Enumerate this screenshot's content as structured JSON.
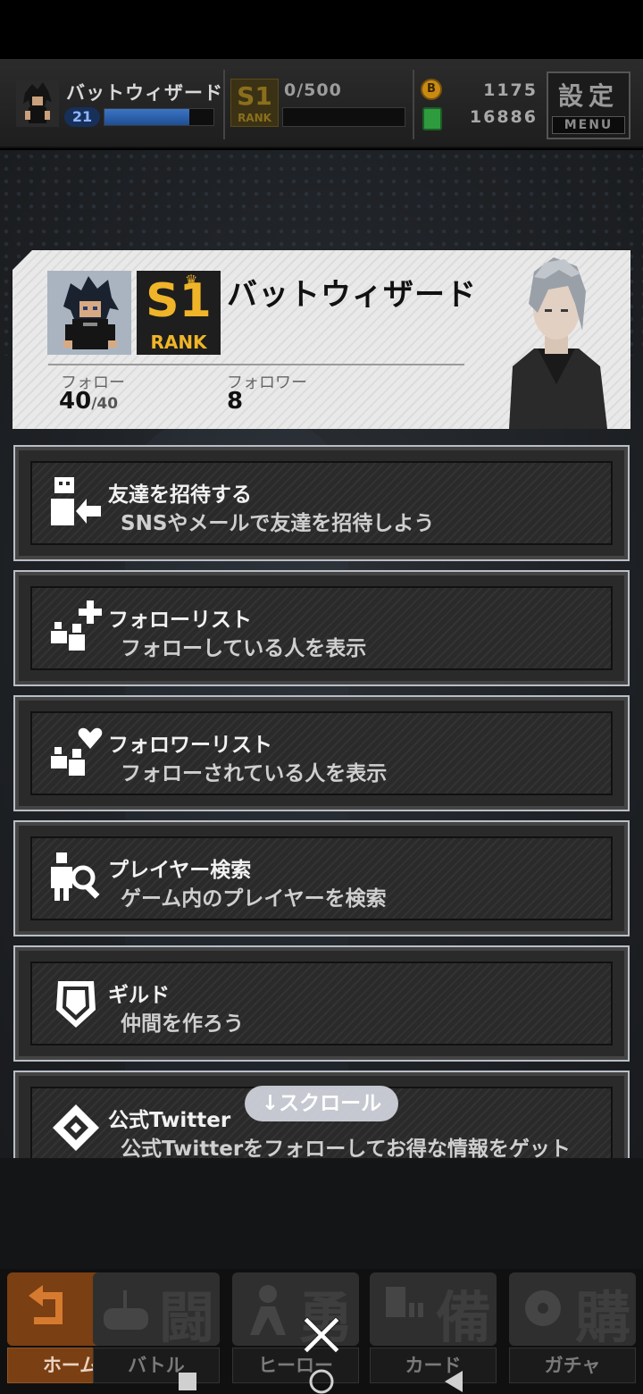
{
  "hud": {
    "player_name": "バットウィザード",
    "level": "21",
    "exp_fraction": 0.78,
    "rank_mini": "S1",
    "rank_mini_label": "RANK",
    "rank_points": "0/500",
    "rank_points_fraction": 0.0,
    "currency_1": "1175",
    "currency_2": "16886",
    "coin_icon_letter": "B",
    "menu_kanji": "設定",
    "menu_label": "MENU"
  },
  "profile": {
    "name": "バットウィザード",
    "rank_number": "S1",
    "rank_label": "RANK",
    "follow_label": "フォロー",
    "follow_count": "40",
    "follow_max": "/40",
    "follower_label": "フォロワー",
    "follower_count": "8"
  },
  "menu": [
    {
      "title": "友達を招待する",
      "subtitle": "SNSやメールで友達を招待しよう",
      "icon": "invite-friend-icon"
    },
    {
      "title": "フォローリスト",
      "subtitle": "フォローしている人を表示",
      "icon": "follow-add-icon"
    },
    {
      "title": "フォロワーリスト",
      "subtitle": "フォローされている人を表示",
      "icon": "follower-heart-icon"
    },
    {
      "title": "プレイヤー検索",
      "subtitle": "ゲーム内のプレイヤーを検索",
      "icon": "player-search-icon"
    },
    {
      "title": "ギルド",
      "subtitle": "仲間を作ろう",
      "icon": "guild-shield-icon"
    },
    {
      "title": "公式Twitter",
      "subtitle": "公式Twitterをフォローしてお得な情報をゲット",
      "icon": "twitter-diamond-icon"
    }
  ],
  "scroll_hint": "↓スクロール",
  "tabs": [
    {
      "label": "ホーム",
      "glyph": "",
      "active": true
    },
    {
      "label": "バトル",
      "glyph": "闘",
      "active": false
    },
    {
      "label": "ヒーロー",
      "glyph": "勇",
      "active": false
    },
    {
      "label": "カード",
      "glyph": "備",
      "active": false
    },
    {
      "label": "ガチャ",
      "glyph": "購",
      "active": false
    }
  ],
  "colors": {
    "accent_orange": "#7a3f12",
    "rank_gold": "#f0b429",
    "exp_blue": "#3c74c4"
  }
}
